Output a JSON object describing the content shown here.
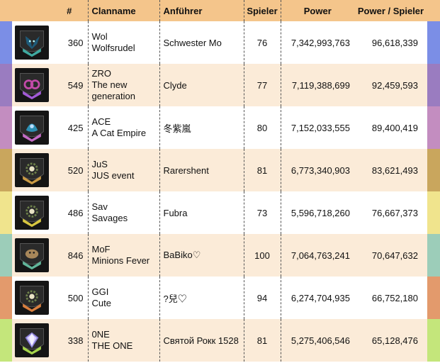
{
  "headers": {
    "rank": "#",
    "clan": "Clanname",
    "leader": "Anführer",
    "players": "Spieler",
    "power": "Power",
    "power_per_player": "Power / Spieler"
  },
  "rows": [
    {
      "id": "360",
      "tag": "Wol",
      "name": "Wolfsrudel",
      "leader": "Schwester Mo",
      "players": "76",
      "power": "7,342,993,763",
      "pps": "96,618,339",
      "color": "#7b8ee6",
      "emblem": "wolf-emblem",
      "shield": "#3fa9a0",
      "accent": "#1e5a78"
    },
    {
      "id": "549",
      "tag": "ZRO",
      "name": "The new generation",
      "leader": "Clyde",
      "players": "77",
      "power": "7,119,388,699",
      "pps": "92,459,593",
      "color": "#9a7cc0",
      "emblem": "mask-emblem",
      "shield": "#a25bd6",
      "accent": "#c24aa8"
    },
    {
      "id": "425",
      "tag": "ACE",
      "name": "A Cat Empire",
      "leader": "冬紫嵐",
      "players": "80",
      "power": "7,152,033,555",
      "pps": "89,400,419",
      "color": "#c38dc0",
      "emblem": "cat-emblem",
      "shield": "#c46bc6",
      "accent": "#2d8fb3"
    },
    {
      "id": "520",
      "tag": "JuS",
      "name": "JUS event",
      "leader": "Rarershent",
      "players": "81",
      "power": "6,773,340,903",
      "pps": "83,621,493",
      "color": "#c9a65d",
      "emblem": "gear-emblem",
      "shield": "#c99a44",
      "accent": "#6c7f4a"
    },
    {
      "id": "486",
      "tag": "Sav",
      "name": "Savages",
      "leader": "Fubra",
      "players": "73",
      "power": "5,596,718,260",
      "pps": "76,667,373",
      "color": "#f0e48d",
      "emblem": "gear-emblem",
      "shield": "#d7c640",
      "accent": "#6c7f4a"
    },
    {
      "id": "846",
      "tag": "MoF",
      "name": "Minions Fever",
      "leader": "BaBiko♡",
      "players": "100",
      "power": "7,064,763,241",
      "pps": "70,647,632",
      "color": "#9ccdb9",
      "emblem": "beast-emblem",
      "shield": "#61b59a",
      "accent": "#a8875a"
    },
    {
      "id": "500",
      "tag": "GGI",
      "name": "Cute",
      "leader": "?兒♡",
      "players": "94",
      "power": "6,274,704,935",
      "pps": "66,752,180",
      "color": "#e39a6c",
      "emblem": "gear-emblem",
      "shield": "#d97f3e",
      "accent": "#6c7f4a"
    },
    {
      "id": "338",
      "tag": "0NE",
      "name": "THE ONE",
      "leader": "Святой Рокк 1528",
      "players": "81",
      "power": "5,275,406,546",
      "pps": "65,128,476",
      "color": "#c4e67b",
      "emblem": "diamond-emblem",
      "shield": "#a6d44a",
      "accent": "#8a7fd8"
    }
  ]
}
